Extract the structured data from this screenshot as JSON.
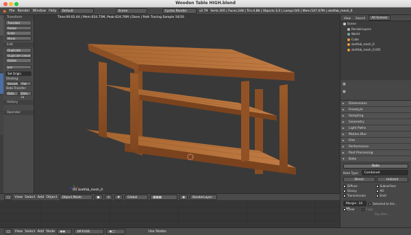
{
  "window": {
    "title": "Wooden Table HIGH.blend"
  },
  "menu": {
    "file": "File",
    "render": "Render",
    "window": "Window",
    "help": "Help",
    "layout": "Default",
    "scene": "Scene",
    "engine": "Cycles Render",
    "version": "v2.79",
    "stats": "Verts:305 | Faces:248 | Tris:4.88 | Objects:1/3 | Lamps:0/0 | Mem:547.07M | sketfab_mesh_0"
  },
  "viewport": {
    "hud": "Time:00:02.44 | Mem:624.75M, Peak:624.76M | Done | Path Tracing Sample 10/10",
    "object_label": "(1) sketfab_mesh_0"
  },
  "toolshelf": {
    "transform_header": "Transform",
    "translate": "Translate",
    "rotate": "Rotate",
    "scale": "Scale",
    "mirror": "Mirror",
    "edit_header": "Edit",
    "duplicate": "Duplicate",
    "duplicate_linked": "Duplicate Linked",
    "delete": "Delete",
    "join": "Join",
    "set_origin": "Set Origin",
    "shading_label": "Shading:",
    "smooth": "Smooth",
    "flat": "Flat",
    "data_transfer_label": "Data Transfer:",
    "data": "Data",
    "data_la": "Data La",
    "history_header": "History",
    "operator_header": "Operator"
  },
  "vtabs": [
    "Tools",
    "Create",
    "Relations",
    "Animation",
    "Physics",
    "Grease Pencil"
  ],
  "view_header": {
    "view": "View",
    "select": "Select",
    "add": "Add",
    "object": "Object",
    "mode": "Object Mode",
    "orientation": "Global",
    "layer": "RenderLayer"
  },
  "bottom_header": {
    "view": "View",
    "select": "Select",
    "add": "Add",
    "node": "Node",
    "pass": "DIFFUSE",
    "use_nodes": "Use Nodes"
  },
  "outliner": {
    "tabs": [
      "View",
      "Search",
      "All Scenes"
    ],
    "items": [
      "Scene",
      "RenderLayers",
      "World",
      "Cube",
      "sketfab_mesh_0",
      "sketfab_mesh_0.001"
    ]
  },
  "properties": {
    "panels": [
      "Dimensions",
      "Freestyle",
      "Sampling",
      "Geometry",
      "Light Paths",
      "Motion Blur",
      "Film",
      "Performance",
      "Post Processing",
      "Bake"
    ],
    "bake_button": "Bake",
    "bake_type_label": "Bake Type:",
    "bake_type_value": "Combined",
    "direct": "Direct",
    "indirect": "Indirect",
    "diffuse": "Diffuse",
    "subsurface": "Subsurface",
    "glossy": "Glossy",
    "ao": "AO",
    "transmission": "Transmission",
    "emit": "Emit",
    "margin": "Margin:",
    "margin_value": "16 px",
    "selected_to_active": "Selected to Act...",
    "clear": "Clear",
    "cage": "Cage",
    "ray_distance": "Ray Dist..."
  },
  "colors": {
    "accent": "#5680c2",
    "wood": "#b56f38",
    "viewport_bg": "#393939"
  }
}
